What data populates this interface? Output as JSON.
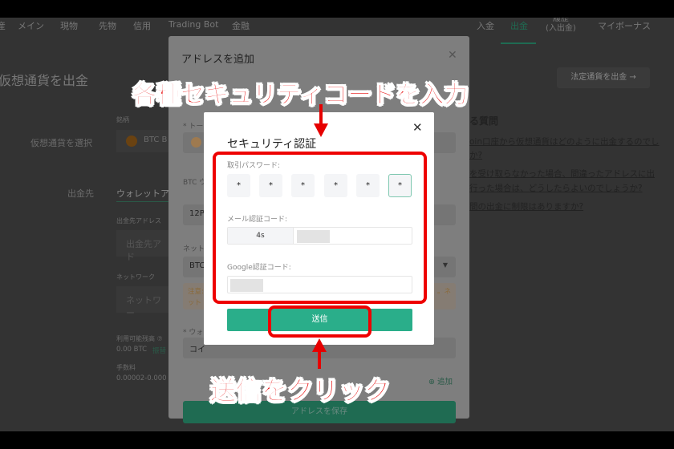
{
  "nav": {
    "items": [
      "産",
      "メイン",
      "現物",
      "先物",
      "信用",
      "Trading Bot",
      "金融"
    ],
    "right": [
      "入金",
      "出金",
      "履歴\n(入出金)",
      "マイボーナス"
    ],
    "active": "出金"
  },
  "page": {
    "title": "仮想通貨を出金",
    "fiat_button": "法定通貨を出金 →",
    "select_crypto_label": "仮想通貨を選択",
    "coin_label": "銘柄",
    "coin_value": "BTC B",
    "destination_label": "出金先",
    "destination_tab": "ウォレットア",
    "address_label": "出金先アドレス",
    "address_placeholder": "出金先アド",
    "network_label": "ネットワーク",
    "network_placeholder": "ネットワー",
    "balance_label": "利用可能残高 ⑦",
    "balance_value": "0.00 BTC",
    "balance_link": "振替",
    "fee_label": "手数料",
    "fee_value": "0.00002-0.000"
  },
  "faq": {
    "title": "る質問",
    "links": [
      "oin口座から仮想通貨はどのように出金するのでし",
      "か?",
      "を受け取らなかった場合、間違ったアドレスに出",
      "行った場合は、どうしたらよいのでしょうか?",
      "間の出金に制限はありますか?"
    ]
  },
  "add_address_modal": {
    "title": "アドレスを追加",
    "token_label": "* トー",
    "btc_wallet_label": "BTC ウ",
    "btc_wallet_value": "12P",
    "network_label": "ネット",
    "network_value": "BTC",
    "warning_text": [
      "注意:",
      "ット"
    ],
    "warning_tail": "。ネ",
    "wallet_label": "* ウォ",
    "wallet_value": "コイ",
    "add_link": "追加",
    "save_button": "アドレスを保存"
  },
  "security_modal": {
    "title": "セキュリティ認証",
    "password_label": "取引パスワード:",
    "password_digits": [
      "*",
      "*",
      "*",
      "*",
      "*",
      "*"
    ],
    "email_label": "メール認証コード:",
    "email_countdown": "4s",
    "google_label": "Google認証コード:",
    "submit": "送信"
  },
  "annotations": {
    "top": "各種セキュリティコードを入力",
    "bottom": "送信をクリック",
    "color": "#e60000"
  },
  "colors": {
    "accent": "#2aae8a",
    "overlay": "#333333"
  }
}
